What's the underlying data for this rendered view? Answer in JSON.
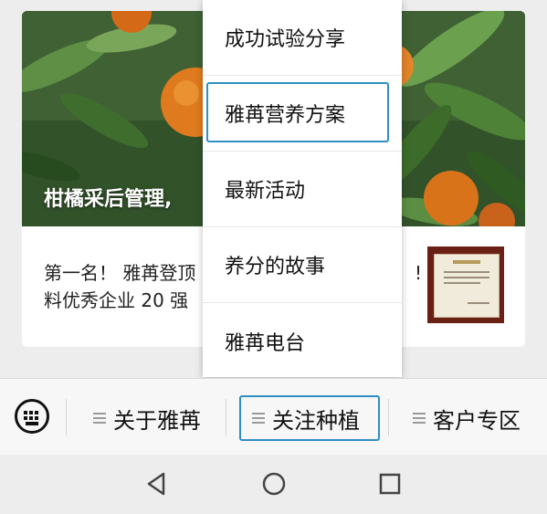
{
  "article_card": {
    "hero_title": "柑橘采后管理,",
    "text_line1": "第一名！ 雅苒登顶",
    "text_line1_tail": "!",
    "text_line2": "料优秀企业 20 强"
  },
  "dropdown_menu": {
    "items": [
      {
        "label": "成功试验分享"
      },
      {
        "label": "雅苒营养方案"
      },
      {
        "label": "最新活动"
      },
      {
        "label": "养分的故事"
      },
      {
        "label": "雅苒电台"
      }
    ]
  },
  "tab_bar": {
    "keyboard_icon": "keyboard-icon",
    "tabs": [
      {
        "label": "关于雅苒"
      },
      {
        "label": "关注种植"
      },
      {
        "label": "客户专区"
      }
    ]
  },
  "nav_bar": {
    "back_icon": "triangle-back-icon",
    "home_icon": "circle-home-icon",
    "recents_icon": "square-recents-icon"
  },
  "colors": {
    "focus_outline": "#2f8ec4",
    "background": "#ededed"
  }
}
